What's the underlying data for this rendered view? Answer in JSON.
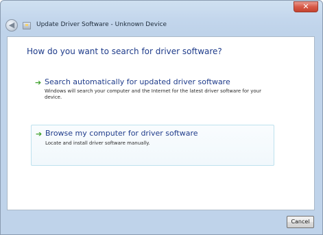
{
  "window": {
    "title": "Update Driver Software - Unknown Device",
    "back_symbol": "◀",
    "close_symbol": "✕"
  },
  "main": {
    "heading": "How do you want to search for driver software?",
    "options": [
      {
        "title": "Search automatically for updated driver software",
        "description": "Windows will search your computer and the Internet for the latest driver software for your device.",
        "icon": "green-arrow-icon"
      },
      {
        "title": "Browse my computer for driver software",
        "description": "Locate and install driver software manually.",
        "icon": "green-arrow-icon"
      }
    ]
  },
  "footer": {
    "cancel_label": "Cancel"
  },
  "colors": {
    "heading": "#1e3b8a",
    "arrow": "#3fa12c",
    "chrome": "#c3d6ec"
  }
}
